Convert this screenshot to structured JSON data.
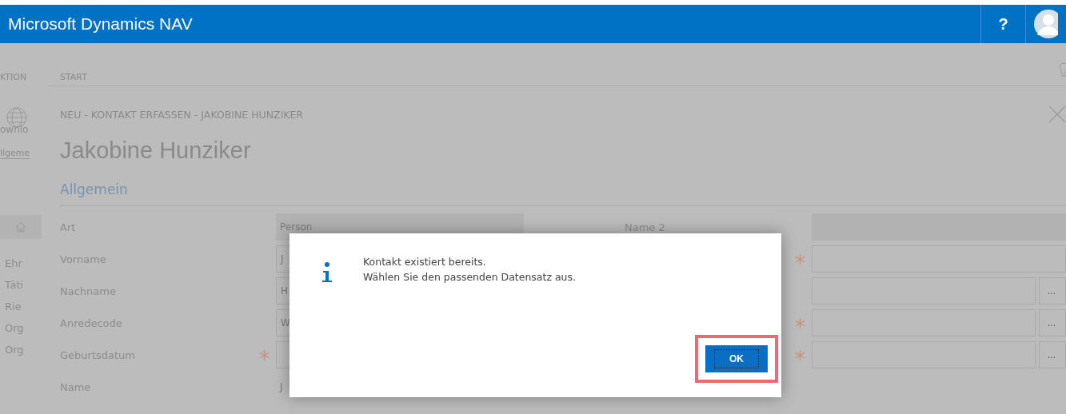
{
  "app": {
    "title": "Microsoft Dynamics NAV",
    "help": "?"
  },
  "sidebar": {
    "tab": "KTION",
    "action": "ownlo",
    "link": "llgeme",
    "nav_items": [
      "Ehr",
      "Täti",
      "Rie",
      "Org",
      "Org"
    ]
  },
  "ribbon": {
    "tabs": [
      "START"
    ]
  },
  "page": {
    "caption": "NEU - KONTAKT ERFASSEN - JAKOBINE HUNZIKER",
    "name": "Jakobine Hunziker",
    "section": "Allgemein",
    "fields_left": [
      {
        "label": "Art",
        "value": "Person",
        "kind": "readonly",
        "required": false
      },
      {
        "label": "Vorname",
        "value": "J",
        "kind": "input",
        "required": false
      },
      {
        "label": "Nachname",
        "value": "H",
        "kind": "input",
        "required": false
      },
      {
        "label": "Anredecode",
        "value": "W",
        "kind": "input",
        "required": false
      },
      {
        "label": "Geburtsdatum",
        "kind": "input",
        "required": true
      },
      {
        "label": "Name",
        "value": "J",
        "kind": "text",
        "required": false
      }
    ],
    "fields_right": [
      {
        "label": "Name 2",
        "kind": "readonly",
        "required": false
      },
      {
        "kind": "input",
        "required": true
      },
      {
        "kind": "input",
        "required": false,
        "lookup": "..."
      },
      {
        "kind": "input",
        "required": true,
        "lookup": "..."
      },
      {
        "kind": "input",
        "required": true,
        "lookup": "..."
      }
    ]
  },
  "dialog": {
    "message": [
      "Kontakt existiert bereits.",
      "Wählen Sie den passenden Datensatz aus."
    ],
    "button": {
      "label": "OK",
      "focused": true
    },
    "highlighted": true
  }
}
